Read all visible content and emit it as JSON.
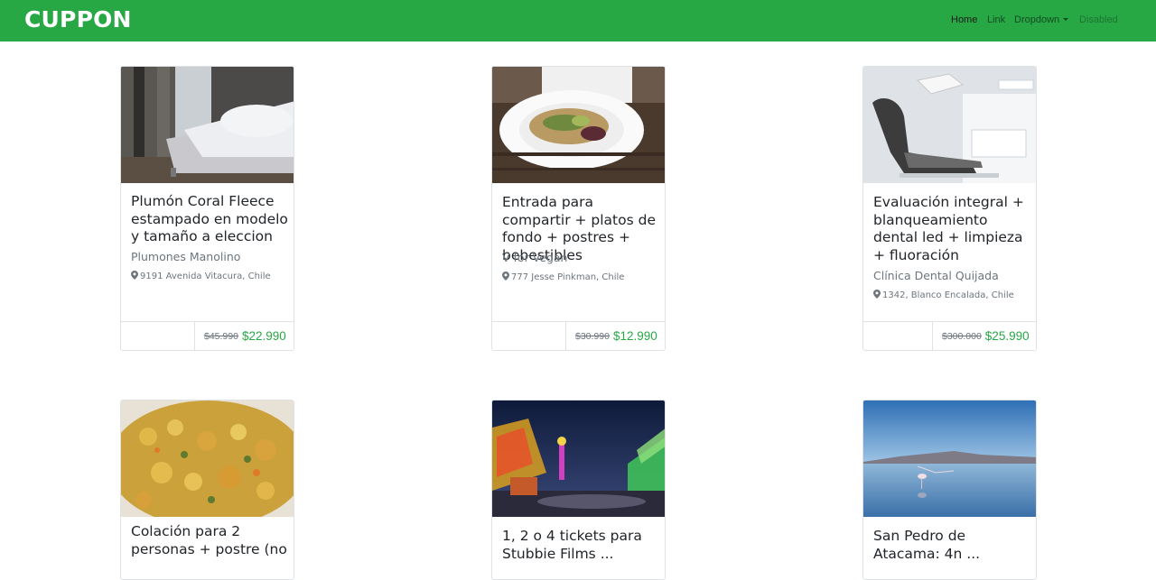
{
  "navbar": {
    "brand": "CUPPON",
    "links": [
      {
        "label": "Home"
      },
      {
        "label": "Link"
      },
      {
        "label": "Dropdown"
      },
      {
        "label": "Disabled"
      }
    ]
  },
  "cards": [
    {
      "title": "Plumón Coral Fleece estampado en modelo y tamaño a eleccion",
      "merchant": "Plumones Manolino",
      "address": "9191 Avenida Vitacura, Chile",
      "old_price": "$45.990",
      "new_price": "$22.990",
      "image": "bedroom-image"
    },
    {
      "title": "Entrada para compartir + platos de fondo + postres + bebestibles",
      "merchant": "V for Vegan",
      "address": "777 Jesse Pinkman, Chile",
      "old_price": "$30.990",
      "new_price": "$12.990",
      "image": "salad-plate-image"
    },
    {
      "title": "Evaluación integral + blanqueamiento dental led + limpieza + fluoración",
      "merchant": "Clínica Dental Quijada",
      "address": "1342, Blanco Encalada, Chile",
      "old_price": "$300.000",
      "new_price": "$25.990",
      "image": "dental-chair-image"
    },
    {
      "title": "Colación para 2 personas + postre (no",
      "image": "stew-image"
    },
    {
      "title": "1, 2 o 4 tickets para Stubbie Films ...",
      "image": "fairground-night-image"
    },
    {
      "title": "San Pedro de Atacama: 4n ...",
      "image": "salt-lake-flamingo-image"
    }
  ],
  "colors": {
    "brand_green": "#28a745",
    "price_green": "#28a745",
    "muted": "#6c757d"
  }
}
